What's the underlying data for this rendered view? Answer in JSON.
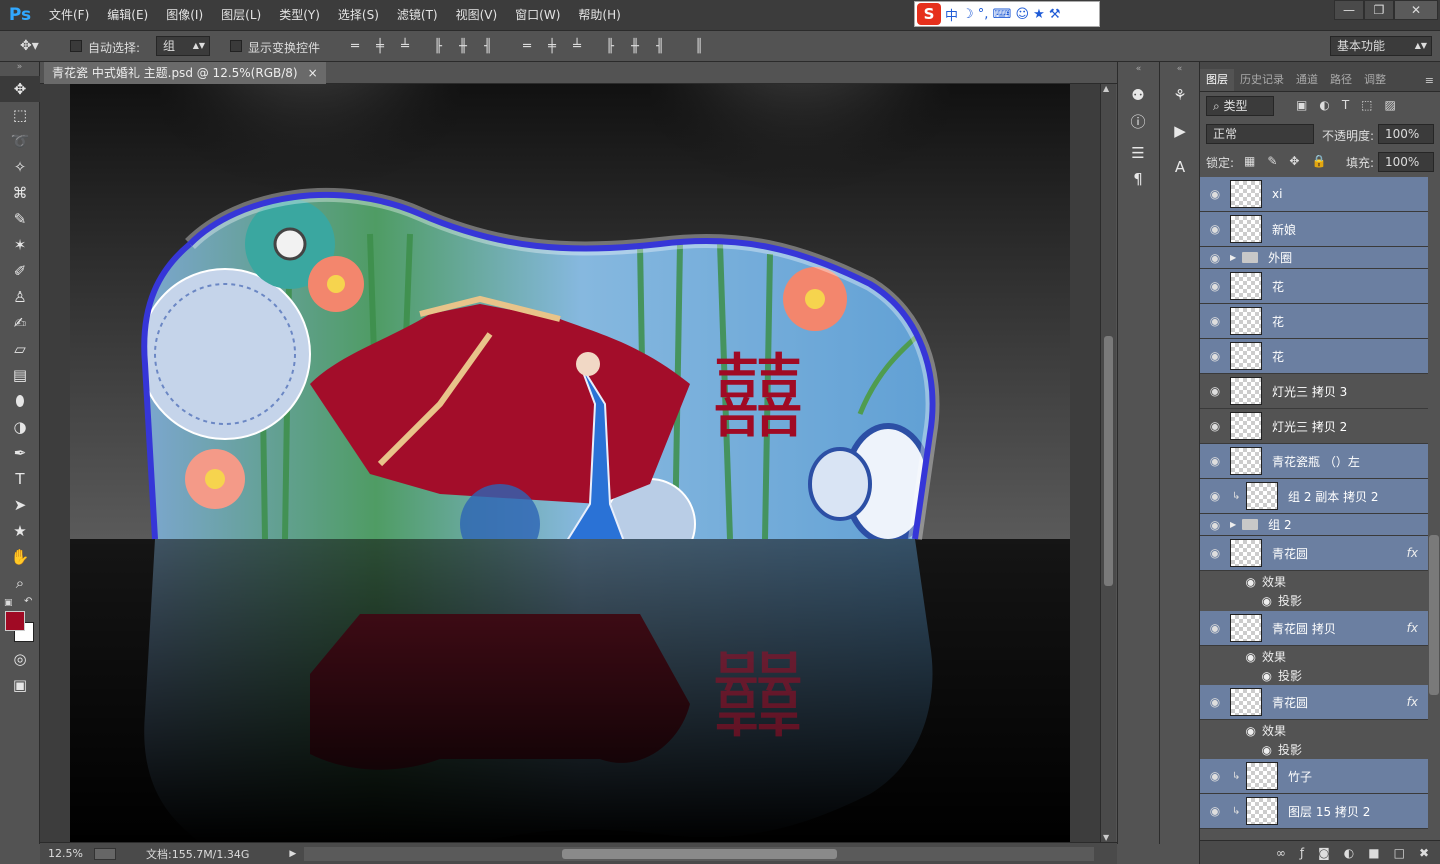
{
  "app": {
    "logo": "Ps"
  },
  "menu": [
    "文件(F)",
    "编辑(E)",
    "图像(I)",
    "图层(L)",
    "类型(Y)",
    "选择(S)",
    "滤镜(T)",
    "视图(V)",
    "窗口(W)",
    "帮助(H)"
  ],
  "ime": {
    "logo": "S",
    "mode": "中",
    "symbols": "☽ °, ⌨ ☺ ★ ⚒"
  },
  "window_controls": {
    "minimize": "—",
    "restore": "❐",
    "close": "✕"
  },
  "options": {
    "auto_select_label": "自动选择:",
    "auto_select_value": "组",
    "show_transform_label": "显示变换控件",
    "workspace": "基本功能"
  },
  "document": {
    "tab_title": "青花瓷 中式婚礼 主题.psd @ 12.5%(RGB/8)",
    "tab_close": "×",
    "zoom": "12.5%",
    "doc_size": "文档:155.7M/1.34G",
    "artwork_text": "囍"
  },
  "colors": {
    "foreground": "#a00a24",
    "background": "#ffffff",
    "selected_layer": "#6b7fa1",
    "frame_stroke": "#3636d8"
  },
  "layers_panel": {
    "tabs": [
      "图层",
      "历史记录",
      "通道",
      "路径",
      "调整"
    ],
    "filter_label": "⌕ 类型",
    "blend_mode": "正常",
    "opacity_label": "不透明度:",
    "opacity_value": "100%",
    "lock_label": "锁定:",
    "fill_label": "填充:",
    "fill_value": "100%",
    "layers": [
      {
        "name": "xi"
      },
      {
        "name": "新娘"
      },
      {
        "name": "外圈"
      },
      {
        "name": "花"
      },
      {
        "name": "花"
      },
      {
        "name": "花"
      },
      {
        "name": "灯光三 拷贝 3"
      },
      {
        "name": "灯光三 拷贝 2"
      },
      {
        "name": "青花瓷瓶 （）左"
      },
      {
        "name": "组 2 副本 拷贝 2"
      },
      {
        "name": "组 2"
      },
      {
        "name": "青花圆",
        "fx": "fx",
        "effect": "效果",
        "sub": "投影"
      },
      {
        "name": "青花圆 拷贝",
        "fx": "fx",
        "effect": "效果",
        "sub": "投影"
      },
      {
        "name": "青花圆",
        "fx": "fx",
        "effect": "效果",
        "sub": "投影"
      },
      {
        "name": "竹子"
      },
      {
        "name": "图层 15 拷贝 2"
      }
    ]
  }
}
